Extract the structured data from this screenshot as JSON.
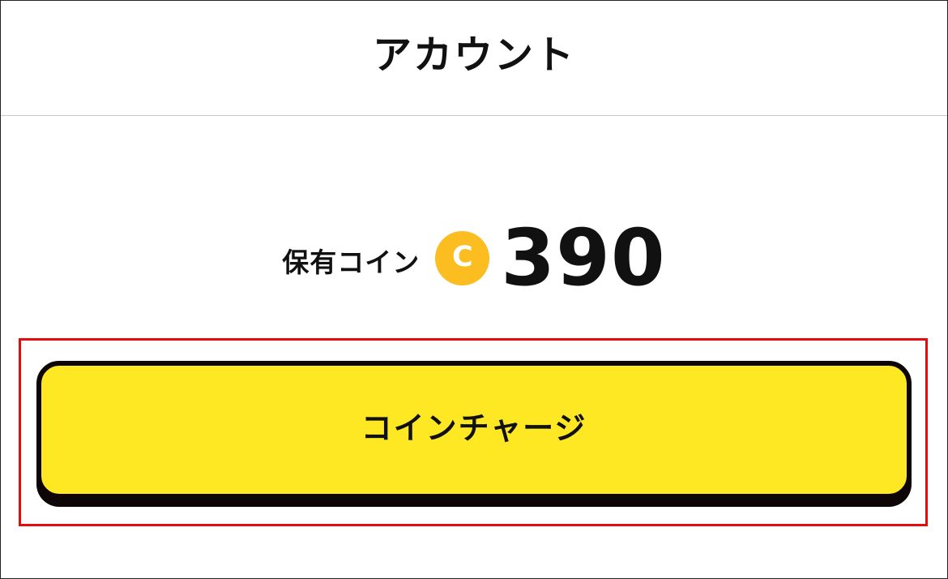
{
  "header": {
    "title": "アカウント"
  },
  "balance": {
    "label": "保有コイン",
    "coin_icon": "coin-icon",
    "coin_letter": "C",
    "amount": "390"
  },
  "actions": {
    "charge_label": "コインチャージ"
  },
  "colors": {
    "page_background": "#ffffff",
    "coin": "#fbbd1f",
    "button": "#fde823",
    "button_shadow": "#0e0606",
    "highlight": "#e30d0d"
  }
}
